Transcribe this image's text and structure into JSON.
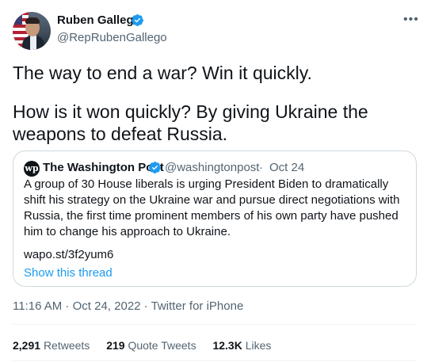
{
  "author": {
    "name": "Ruben Gallego",
    "handle": "@RepRubenGallego",
    "verified": true
  },
  "tweet": {
    "line1": "The way to end a war? Win it quickly.",
    "line2": "How is it won quickly? By giving Ukraine the weapons to defeat Russia."
  },
  "quote": {
    "logo_text": "wp",
    "name": "The Washington Post",
    "handle": "@washingtonpost",
    "separator": "·",
    "date": "Oct 24",
    "body": "A group of 30 House liberals is urging President Biden to dramatically shift his strategy on the Ukraine war and pursue direct negotiations with Russia, the first time prominent members of his own party have pushed him to change his approach to Ukraine.",
    "link": "wapo.st/3f2yum6",
    "show_thread": "Show this thread"
  },
  "meta": {
    "time": "11:16 AM",
    "sep1": " · ",
    "date": "Oct 24, 2022",
    "sep2": " · ",
    "source": "Twitter for iPhone"
  },
  "stats": {
    "retweets_count": "2,291",
    "retweets_label": "Retweets",
    "quotes_count": "219",
    "quotes_label": "Quote Tweets",
    "likes_count": "12.3K",
    "likes_label": "Likes"
  },
  "colors": {
    "accent": "#1d9bf0",
    "text": "#0f1419",
    "secondary": "#536471",
    "border": "#cfd9de"
  },
  "icons": {
    "verified": "verified-badge-icon",
    "more": "more-horizontal-icon"
  }
}
